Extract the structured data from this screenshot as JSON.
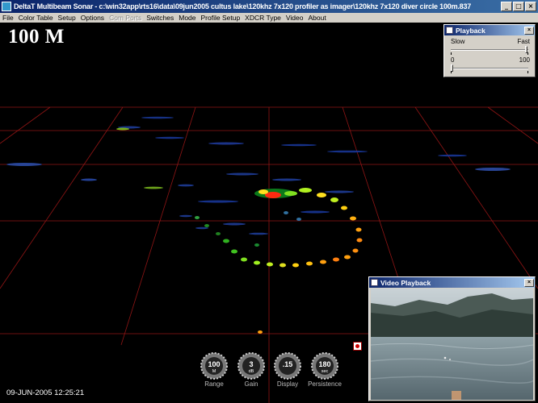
{
  "window": {
    "title": "DeltaT Multibeam Sonar - c:\\win32app\\rts16\\data\\09jun2005 cultus lake\\120khz 7x120 profiler as imager\\120khz 7x120 diver circle 100m.837",
    "minimize_glyph": "_",
    "maximize_glyph": "□",
    "close_glyph": "×"
  },
  "menu": [
    {
      "label": "File",
      "enabled": true
    },
    {
      "label": "Color Table",
      "enabled": true
    },
    {
      "label": "Setup",
      "enabled": true
    },
    {
      "label": "Options",
      "enabled": true
    },
    {
      "label": "Com Ports",
      "enabled": false
    },
    {
      "label": "Switches",
      "enabled": true
    },
    {
      "label": "Mode",
      "enabled": true
    },
    {
      "label": "Profile Setup",
      "enabled": true
    },
    {
      "label": "XDCR Type",
      "enabled": true
    },
    {
      "label": "Video",
      "enabled": true
    },
    {
      "label": "About",
      "enabled": true
    }
  ],
  "viewport": {
    "range_label": "100 M",
    "timestamp": "09-JUN-2005  12:25:21",
    "grid_color": "#b01818"
  },
  "playback": {
    "title": "Playback",
    "close_glyph": "×",
    "speed_min": "Slow",
    "speed_max": "Fast",
    "speed_fraction": 1.0,
    "position_min": "0",
    "position_max": "100",
    "position_fraction": 0.0
  },
  "video": {
    "title": "Video Playback",
    "close_glyph": "×"
  },
  "knobs": [
    {
      "label": "Range",
      "value": "100",
      "unit": "M"
    },
    {
      "label": "Gain",
      "value": "3",
      "unit": "dB"
    },
    {
      "label": "Display",
      "value": ".15",
      "unit": ""
    },
    {
      "label": "Persistence",
      "value": "180",
      "unit": "sec"
    }
  ]
}
